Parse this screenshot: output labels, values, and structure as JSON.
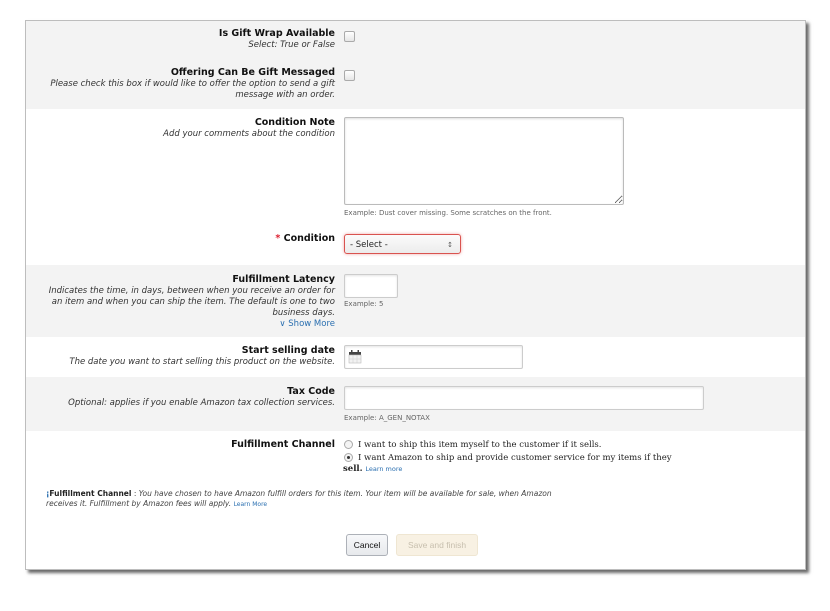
{
  "gift_wrap": {
    "title": "Is Gift Wrap Available",
    "desc": "Select: True or False",
    "checked": false
  },
  "gift_message": {
    "title": "Offering Can Be Gift Messaged",
    "desc1": "Please check this box if would like to offer the option to send a gift",
    "desc2": "message with an order.",
    "checked": false
  },
  "condition_note": {
    "title": "Condition Note",
    "desc": "Add your comments about the condition",
    "value": "",
    "example": "Example:  Dust cover missing. Some scratches on the front."
  },
  "condition": {
    "required_mark": "*",
    "title": "Condition",
    "selected": "- Select -",
    "arrow": "↕"
  },
  "latency": {
    "title": "Fulfillment Latency",
    "desc1": "Indicates the time, in days, between when you receive an order for",
    "desc2": "an item and when you can ship the item.  The default is one to two",
    "desc3": "business days.",
    "show_more_icon": "»",
    "show_more": "Show More",
    "value": "",
    "example": "Example:  5"
  },
  "start_date": {
    "title": "Start selling date",
    "desc": "The date you want to start selling this product on the website.",
    "value": "",
    "icon": "calendar-icon"
  },
  "tax_code": {
    "title": "Tax Code",
    "desc": "Optional: applies if you enable Amazon tax collection services.",
    "value": "",
    "example": "Example:  A_GEN_NOTAX"
  },
  "channel": {
    "title": "Fulfillment Channel",
    "options": [
      {
        "label": "I want to ship this item myself to the customer if it sells.",
        "selected": false
      },
      {
        "label": "I want Amazon to ship and provide customer service for my items if they",
        "label2": "sell.",
        "learn_more": "Learn more",
        "selected": true
      }
    ]
  },
  "info": {
    "icon": "¡",
    "title": "Fulfillment Channel",
    "sep": " : ",
    "text1": "You have chosen to have Amazon fulfill orders for this item. Your item will be available for sale, when Amazon",
    "text2": "receives it. Fulfillment by Amazon fees will apply.",
    "learn_more": "Learn More"
  },
  "buttons": {
    "cancel": "Cancel",
    "save": "Save and finish"
  }
}
